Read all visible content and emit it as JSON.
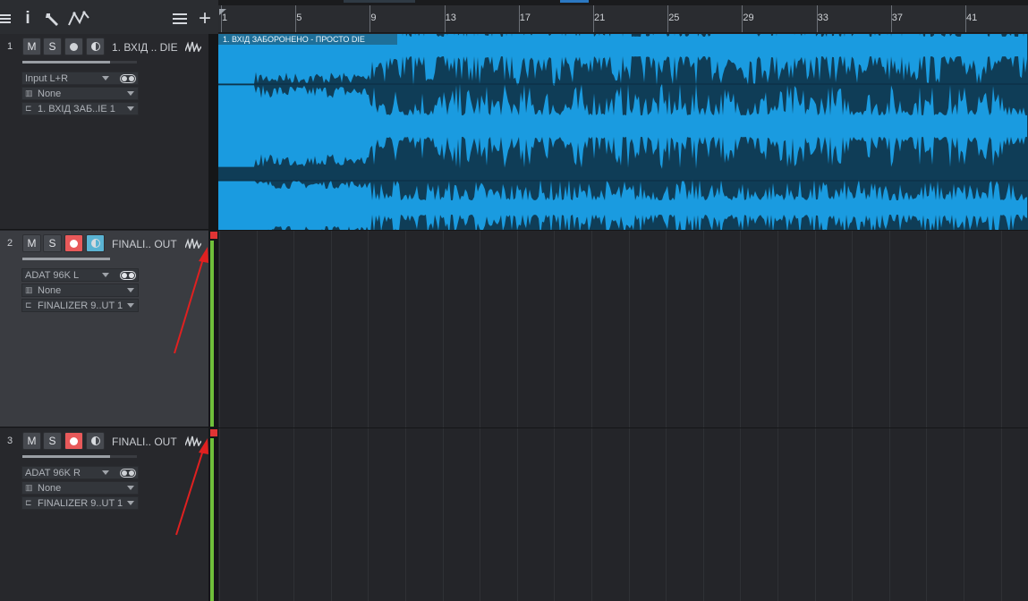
{
  "ruler": {
    "bars": [
      "1",
      "5",
      "9",
      "13",
      "17",
      "21",
      "25",
      "29",
      "33",
      "37",
      "41"
    ]
  },
  "toolbar": {
    "icons": [
      "menu-icon",
      "info-icon",
      "wrench-icon",
      "automation-icon",
      "list-icon",
      "add-icon"
    ],
    "info_glyph": "i",
    "add_glyph": "+"
  },
  "tracks": [
    {
      "number": "1",
      "mute": "M",
      "solo": "S",
      "record_armed": false,
      "monitor_on": false,
      "name": "1. ВХІД .. DIE",
      "input": "Input L+R",
      "instrument": "None",
      "output": "1. ВХІД ЗАБ..IE 1"
    },
    {
      "number": "2",
      "mute": "M",
      "solo": "S",
      "record_armed": true,
      "monitor_on": true,
      "name": "FINALI.. OUT",
      "input": "ADAT 96K L",
      "instrument": "None",
      "output": "FINALIZER 9..UT 1"
    },
    {
      "number": "3",
      "mute": "M",
      "solo": "S",
      "record_armed": true,
      "monitor_on": false,
      "name": "FINALI.. OUT",
      "input": "ADAT 96K R",
      "instrument": "None",
      "output": "FINALIZER 9..UT 1"
    }
  ],
  "clip": {
    "title": "1. ВХІД ЗАБОРОНЕНО - ПРОСТО DIE"
  },
  "colors": {
    "waveform": "#1a9be0",
    "clip_bg": "#0f3d57",
    "record": "#e8595a",
    "monitor": "#5ab3d3",
    "meter": "#6fbf3a",
    "annotation_arrow": "#e02020"
  }
}
